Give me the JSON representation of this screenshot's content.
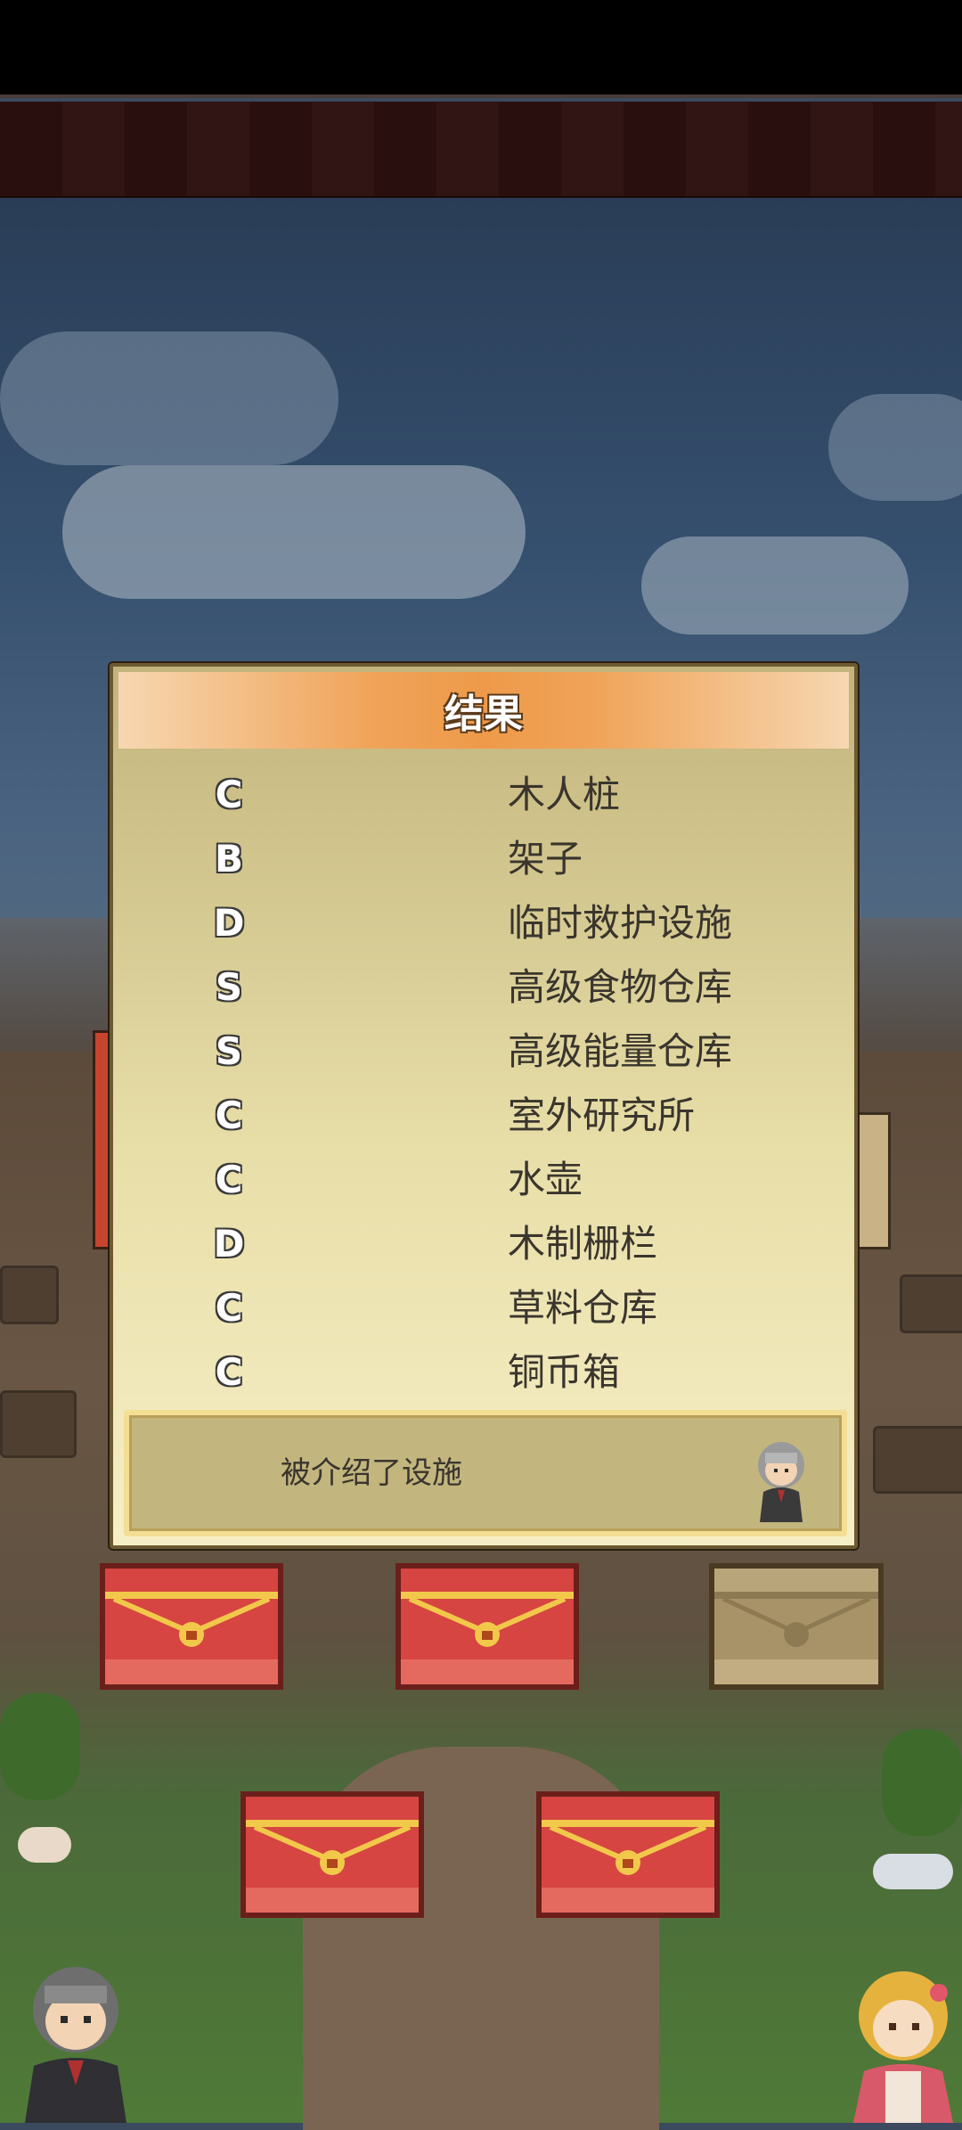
{
  "dialog": {
    "title": "结果",
    "results": [
      {
        "grade": "C",
        "name": "木人桩"
      },
      {
        "grade": "B",
        "name": "架子"
      },
      {
        "grade": "D",
        "name": "临时救护设施"
      },
      {
        "grade": "S",
        "name": "高级食物仓库"
      },
      {
        "grade": "S",
        "name": "高级能量仓库"
      },
      {
        "grade": "C",
        "name": "室外研究所"
      },
      {
        "grade": "C",
        "name": "水壶"
      },
      {
        "grade": "D",
        "name": "木制栅栏"
      },
      {
        "grade": "C",
        "name": "草料仓库"
      },
      {
        "grade": "C",
        "name": "铜币箱"
      }
    ],
    "footer_message": "被介绍了设施"
  },
  "chests": [
    {
      "state": "closed-red"
    },
    {
      "state": "closed-red"
    },
    {
      "state": "opened-wood"
    },
    {
      "state": "closed-red"
    },
    {
      "state": "closed-red"
    }
  ],
  "colors": {
    "header_orange": "#ee9a4a",
    "chest_red": "#d64541",
    "chest_gold": "#f2c84b",
    "dialog_bg": "#e8dea8"
  }
}
